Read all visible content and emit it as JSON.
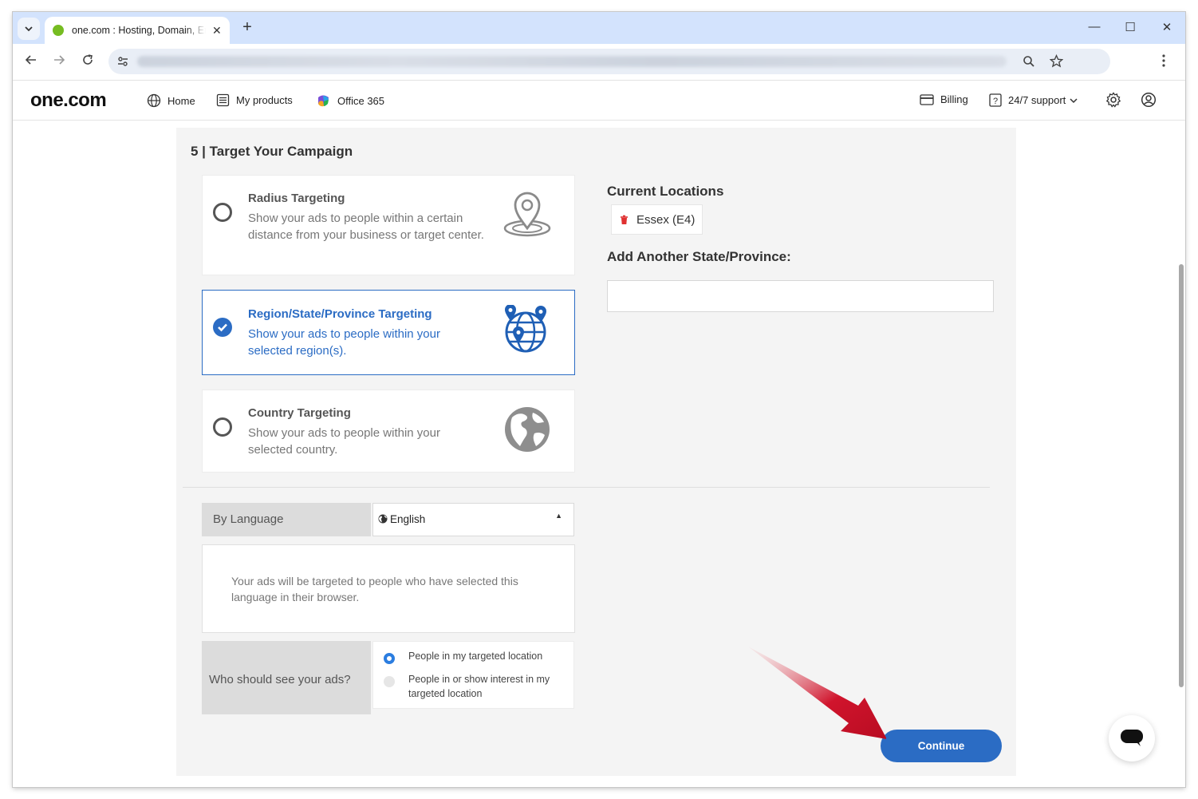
{
  "browser": {
    "tab_title": "one.com : Hosting, Domain, Email",
    "new_tab": "+",
    "tab_close": "✕",
    "minimize": "—",
    "maximize": "☐",
    "close": "✕"
  },
  "site": {
    "logo": "one.com",
    "nav": [
      {
        "label": "Home",
        "icon": "globe-icon"
      },
      {
        "label": "My products",
        "icon": "list-icon"
      },
      {
        "label": "Office 365",
        "icon": "office-icon"
      }
    ],
    "billing": "Billing",
    "support": "24/7 support"
  },
  "campaign": {
    "section_title": "5 | Target Your Campaign",
    "options": [
      {
        "title": "Radius Targeting",
        "description": "Show your ads to people within a certain distance from your business or target center.",
        "selected": false,
        "icon": "map-pin-icon"
      },
      {
        "title": "Region/State/Province Targeting",
        "description": "Show your ads to people within your selected region(s).",
        "selected": true,
        "icon": "globe-pins-icon"
      },
      {
        "title": "Country Targeting",
        "description": "Show your ads to people within your selected country.",
        "selected": false,
        "icon": "earth-icon"
      }
    ],
    "current_locations_title": "Current Locations",
    "locations": [
      "Essex (E4)"
    ],
    "add_title": "Add Another State/Province:",
    "add_value": "",
    "language_label": "By Language",
    "language_value": "English",
    "language_info": "Your ads will be targeted to people who have selected this language in their browser.",
    "audience_label": "Who should see your ads?",
    "audience_options": [
      {
        "label": "People in my targeted location",
        "selected": true
      },
      {
        "label": "People in or show interest in my targeted location",
        "selected": false
      }
    ],
    "continue_label": "Continue"
  },
  "colors": {
    "accent": "#2b6cc4",
    "panel_bg": "#f4f4f4",
    "arrow": "#d0142c"
  }
}
